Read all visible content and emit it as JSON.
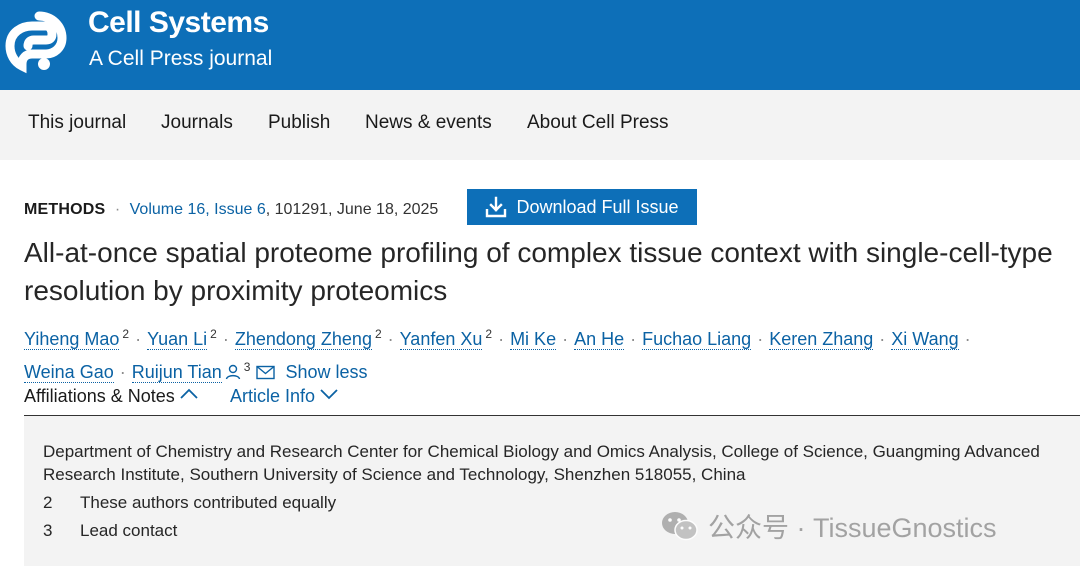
{
  "header": {
    "brand_name": "Cell Systems",
    "brand_subtitle": "A Cell Press journal",
    "background_color": "#0d6fb8",
    "logo_icon": "cell-press-logo-icon"
  },
  "nav": {
    "items": [
      {
        "label": "This journal"
      },
      {
        "label": "Journals"
      },
      {
        "label": "Publish"
      },
      {
        "label": "News & events"
      },
      {
        "label": "About Cell Press"
      }
    ]
  },
  "article": {
    "type": "METHODS",
    "separator": "·",
    "volume_issue": "Volume 16, Issue 6",
    "citation": "101291, June 18, 2025",
    "download_label": "Download Full Issue",
    "title": "All-at-once spatial proteome profiling of complex tissue context with single-cell-type resolution by proximity proteomics",
    "authors": [
      {
        "name": "Yiheng Mao",
        "sup": "2"
      },
      {
        "name": "Yuan Li",
        "sup": "2"
      },
      {
        "name": "Zhendong Zheng",
        "sup": "2"
      },
      {
        "name": "Yanfen Xu",
        "sup": "2"
      },
      {
        "name": "Mi Ke",
        "sup": ""
      },
      {
        "name": "An He",
        "sup": ""
      },
      {
        "name": "Fuchao Liang",
        "sup": ""
      },
      {
        "name": "Keren Zhang",
        "sup": ""
      },
      {
        "name": "Xi Wang",
        "sup": ""
      },
      {
        "name": "Weina Gao",
        "sup": ""
      },
      {
        "name": "Ruijun Tian",
        "sup": "3"
      }
    ],
    "show_less_label": "Show less"
  },
  "tabs": {
    "affiliations_label": "Affiliations & Notes",
    "article_info_label": "Article Info"
  },
  "affiliations": {
    "text": "Department of Chemistry and Research Center for Chemical Biology and Omics Analysis, College of Science, Guangming Advanced Research Institute, Southern University of Science and Technology, Shenzhen 518055, China",
    "notes": [
      {
        "num": "2",
        "text": "These authors contributed equally"
      },
      {
        "num": "3",
        "text": "Lead contact"
      }
    ]
  },
  "watermark": {
    "text": "公众号 · TissueGnostics",
    "icon": "wechat-icon"
  }
}
